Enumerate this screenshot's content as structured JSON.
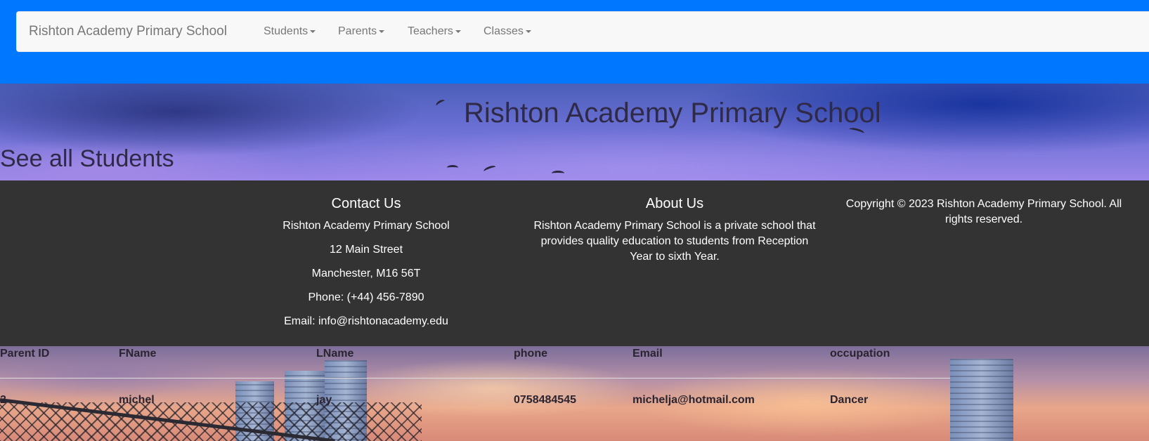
{
  "navbar": {
    "brand": "Rishton Academy Primary School",
    "items": [
      {
        "label": "Students"
      },
      {
        "label": "Parents"
      },
      {
        "label": "Teachers"
      },
      {
        "label": "Classes"
      }
    ]
  },
  "hero": {
    "title": "Rishton Academy Primary School",
    "link": "See all Students"
  },
  "footer": {
    "contact": {
      "heading": "Contact Us",
      "lines": [
        "Rishton Academy Primary School",
        "12 Main Street",
        "Manchester, M16 56T",
        "Phone: (+44) 456-7890",
        "Email: info@rishtonacademy.edu"
      ]
    },
    "about": {
      "heading": "About Us",
      "text": "Rishton Academy Primary School is a private school that provides quality education to students from Reception Year to sixth Year."
    },
    "copyright": "Copyright © 2023 Rishton Academy Primary School. All rights reserved."
  },
  "table": {
    "headers": [
      "Parent ID",
      "FName",
      "LName",
      "phone",
      "Email",
      "occupation"
    ],
    "rows": [
      [
        "2",
        "michel",
        "jay",
        "0758484545",
        "michelja@hotmail.com",
        "Dancer"
      ]
    ]
  },
  "colors": {
    "top_band": "#0077ff",
    "navbar_bg": "#f8f8f8",
    "footer_bg": "#333333",
    "text_dark": "#2e2a48"
  }
}
